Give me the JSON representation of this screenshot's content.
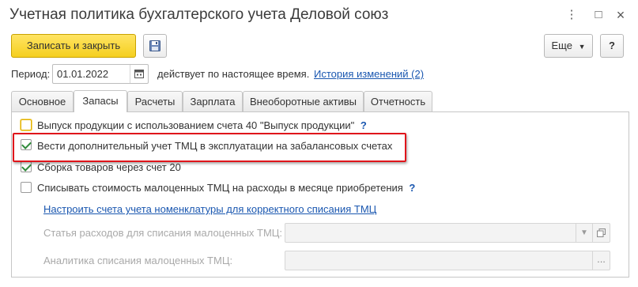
{
  "window": {
    "title": "Учетная политика бухгалтерского учета Деловой союз",
    "more_glyph": "⋮",
    "maximize_glyph": "□",
    "close_glyph": "×"
  },
  "toolbar": {
    "save_close_label": "Записать и закрыть",
    "more_label": "Еще",
    "help_label": "?"
  },
  "period": {
    "label": "Период:",
    "value": "01.01.2022",
    "status_text": "действует по настоящее время.",
    "history_link": "История изменений (2)"
  },
  "tabs": [
    {
      "label": "Основное",
      "active": false
    },
    {
      "label": "Запасы",
      "active": true
    },
    {
      "label": "Расчеты",
      "active": false
    },
    {
      "label": "Зарплата",
      "active": false
    },
    {
      "label": "Внеоборотные активы",
      "active": false
    },
    {
      "label": "Отчетность",
      "active": false
    }
  ],
  "options": [
    {
      "label": "Выпуск продукции с использованием счета 40 \"Выпуск продукции\"",
      "checked": false,
      "help": "?"
    },
    {
      "label": "Вести дополнительный учет ТМЦ в эксплуатации на забалансовых счетах",
      "checked": true
    },
    {
      "label": "Сборка товаров через счет 20",
      "checked": true
    },
    {
      "label": "Списывать стоимость малоценных ТМЦ на расходы в месяце приобретения",
      "checked": false,
      "help": "?"
    }
  ],
  "settings_link": "Настроить счета учета номенклатуры для корректного списания ТМЦ",
  "expense_item": {
    "label": "Статья расходов для списания малоценных ТМЦ:",
    "value": ""
  },
  "analytics": {
    "label": "Аналитика списания малоценных ТМЦ:",
    "value": "",
    "select_glyph": "..."
  },
  "colors": {
    "accent_yellow": "#f5cf1f",
    "link_blue": "#1a57b0",
    "highlight_red": "#e0151b",
    "check_green": "#2f8a3a"
  }
}
